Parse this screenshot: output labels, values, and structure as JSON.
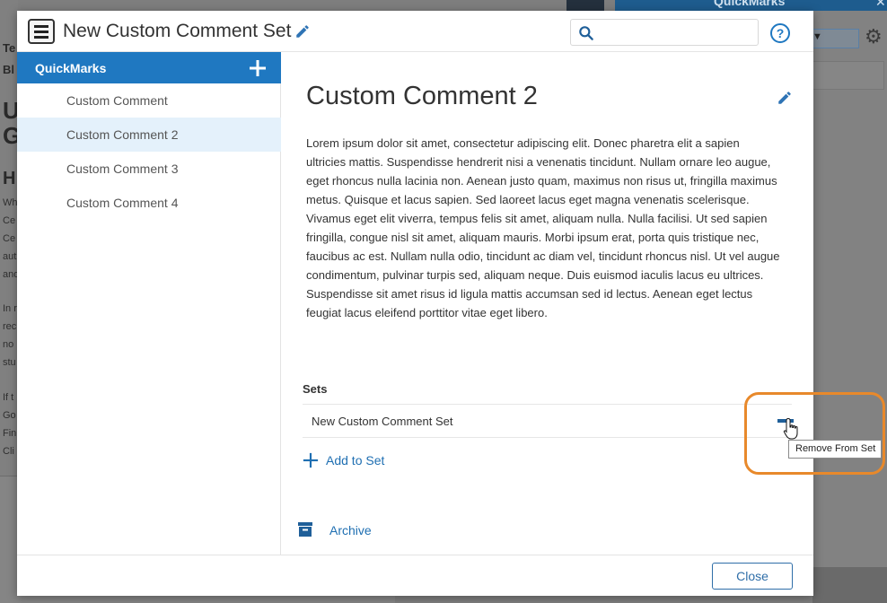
{
  "background": {
    "fragments": [
      "Te",
      "Bl",
      "U",
      "G",
      "H",
      "Wh",
      "Ce",
      "Ce",
      "aut",
      "and",
      "In r",
      "rec",
      "no",
      "stu",
      "If t",
      "Go",
      "Fin",
      "Cli"
    ],
    "panel_title": "QuickMarks"
  },
  "modal": {
    "title": "New Custom Comment Set",
    "search_placeholder": "",
    "sidebar": {
      "header": "QuickMarks",
      "items": [
        {
          "label": "Custom Comment"
        },
        {
          "label": "Custom Comment 2"
        },
        {
          "label": "Custom Comment 3"
        },
        {
          "label": "Custom Comment 4"
        }
      ],
      "active_index": 1
    },
    "content": {
      "title": "Custom Comment 2",
      "body": "Lorem ipsum dolor sit amet, consectetur adipiscing elit. Donec pharetra elit a sapien ultricies mattis. Suspendisse hendrerit nisi a venenatis tincidunt. Nullam ornare leo augue, eget rhoncus nulla lacinia non. Aenean justo quam, maximus non risus ut, fringilla maximus metus. Quisque et lacus sapien. Sed laoreet lacus eget magna venenatis scelerisque. Vivamus eget elit viverra, tempus felis sit amet, aliquam nulla. Nulla facilisi. Ut sed sapien fringilla, congue nisl sit amet, aliquam mauris. Morbi ipsum erat, porta quis tristique nec, faucibus ac est. Nullam nulla odio, tincidunt ac diam vel, tincidunt rhoncus nisl. Ut vel augue condimentum, pulvinar turpis sed, aliquam neque. Duis euismod iaculis lacus eu ultrices. Suspendisse sit amet risus id ligula mattis accumsan sed id lectus. Aenean eget lectus feugiat lacus eleifend porttitor vitae eget libero.",
      "sets_label": "Sets",
      "sets": [
        {
          "name": "New Custom Comment Set"
        }
      ],
      "add_to_set": "Add to Set",
      "archive": "Archive"
    },
    "footer": {
      "close": "Close"
    },
    "tooltip": "Remove From Set"
  },
  "colors": {
    "accent": "#1f78c1",
    "highlight": "#e8892b",
    "active_item_bg": "#e4f1fb"
  },
  "icons": {
    "menu": "hamburger-icon",
    "edit": "pencil-icon",
    "search": "search-icon",
    "help": "help-circle-icon",
    "add": "plus-icon",
    "remove": "minus-icon",
    "archive": "archive-box-icon",
    "cursor": "hand-pointer-icon"
  }
}
